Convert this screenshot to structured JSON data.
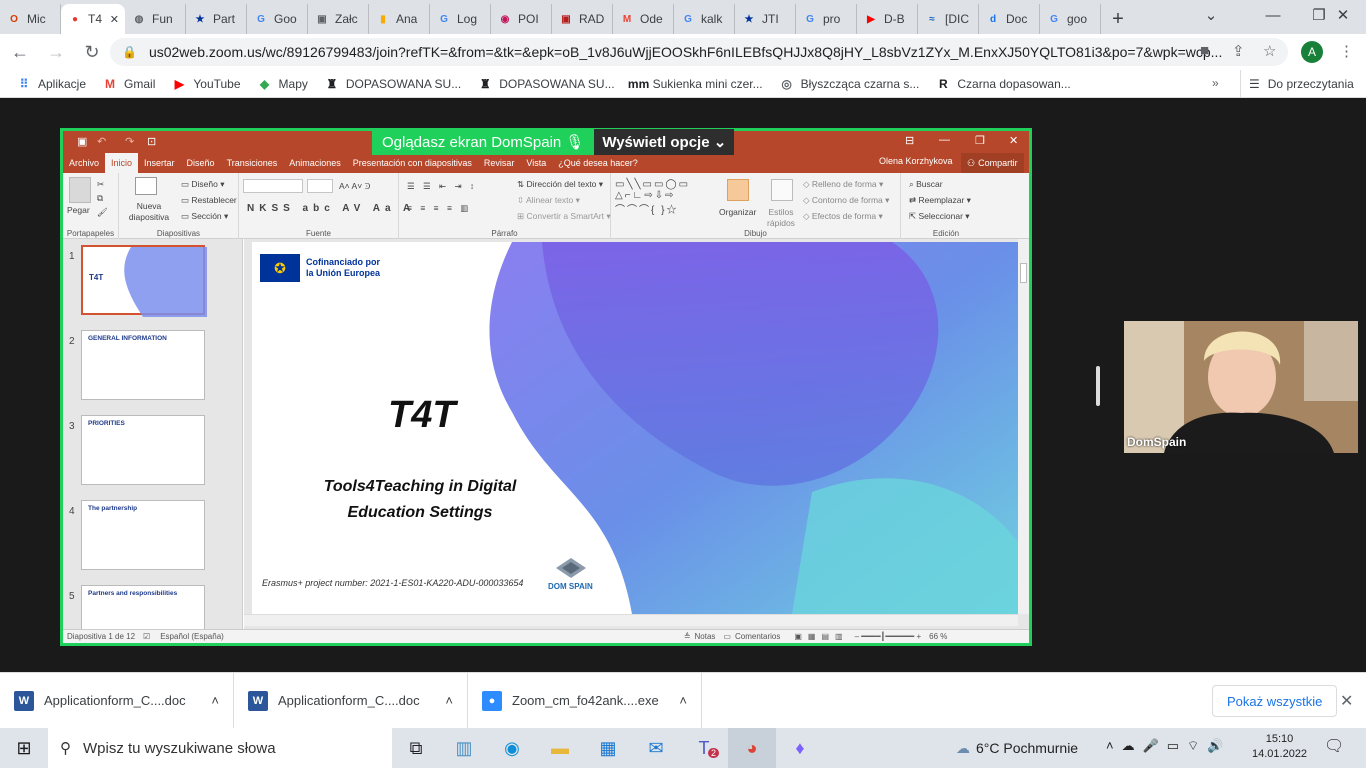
{
  "tabs": [
    {
      "label": "Mic",
      "icon": "office-icon",
      "color": "#d83b01",
      "glyph": "O"
    },
    {
      "label": "T4",
      "icon": "record-icon",
      "color": "#e53935",
      "glyph": "●",
      "active": true
    },
    {
      "label": "Fun",
      "icon": "globe-icon",
      "color": "#5f6368",
      "glyph": "◍"
    },
    {
      "label": "Part",
      "icon": "eu-flag-icon",
      "color": "#003399",
      "glyph": "★"
    },
    {
      "label": "Goo",
      "icon": "google-icon",
      "color": "#4285f4",
      "glyph": "G"
    },
    {
      "label": "Załc",
      "icon": "form-icon",
      "color": "#5f6368",
      "glyph": "▣"
    },
    {
      "label": "Ana",
      "icon": "analytics-icon",
      "color": "#f9ab00",
      "glyph": "▮"
    },
    {
      "label": "Log",
      "icon": "google-icon",
      "color": "#4285f4",
      "glyph": "G"
    },
    {
      "label": "POI",
      "icon": "record-icon",
      "color": "#c2185b",
      "glyph": "◉"
    },
    {
      "label": "RAD",
      "icon": "rad-icon",
      "color": "#b71c1c",
      "glyph": "▣"
    },
    {
      "label": "Ode",
      "icon": "gmail-icon",
      "color": "#ea4335",
      "glyph": "M"
    },
    {
      "label": "kalk",
      "icon": "google-icon",
      "color": "#4285f4",
      "glyph": "G"
    },
    {
      "label": "JTI",
      "icon": "eu-flag-icon",
      "color": "#003399",
      "glyph": "★"
    },
    {
      "label": "pro",
      "icon": "google-icon",
      "color": "#4285f4",
      "glyph": "G"
    },
    {
      "label": "D-B",
      "icon": "youtube-icon",
      "color": "#ff0000",
      "glyph": "▶"
    },
    {
      "label": "[DIC",
      "icon": "dic-icon",
      "color": "#1565c0",
      "glyph": "≈"
    },
    {
      "label": "Doc",
      "icon": "docs-icon",
      "color": "#1a73e8",
      "glyph": "d"
    },
    {
      "label": "goo",
      "icon": "google-icon",
      "color": "#4285f4",
      "glyph": "G"
    }
  ],
  "url": "us02web.zoom.us/wc/89126799483/join?refTK=&from=&tk=&epk=oB_1v8J6uWjjEOOSkhF6nILEBfsQHJJx8Q8jHY_L8sbVz1ZYx_M.EnxXJ50YQLTO81i3&po=7&wpk=wcp...",
  "avatar_letter": "A",
  "bookmarks": [
    {
      "label": "Aplikacje",
      "icon": "apps-grid-icon",
      "glyph": "⠿",
      "color": "#4285f4"
    },
    {
      "label": "Gmail",
      "icon": "gmail-icon",
      "glyph": "M",
      "color": "#ea4335"
    },
    {
      "label": "YouTube",
      "icon": "youtube-icon",
      "glyph": "▶",
      "color": "#ff0000"
    },
    {
      "label": "Mapy",
      "icon": "maps-icon",
      "glyph": "◆",
      "color": "#34a853"
    },
    {
      "label": "DOPASOWANA SU...",
      "icon": "shop-icon",
      "glyph": "♜",
      "color": "#202124"
    },
    {
      "label": "DOPASOWANA SU...",
      "icon": "shop-icon",
      "glyph": "♜",
      "color": "#202124"
    },
    {
      "label": "Sukienka mini czer...",
      "icon": "mm-icon",
      "glyph": "mm",
      "color": "#202124"
    },
    {
      "label": "Błyszcząca czarna s...",
      "icon": "shop-circle-icon",
      "glyph": "◎",
      "color": "#5f6368"
    },
    {
      "label": "Czarna dopasowan...",
      "icon": "r-icon",
      "glyph": "R",
      "color": "#202124"
    }
  ],
  "reading_list": "Do przeczytania",
  "share_banner": {
    "viewing": "Oglądasz ekran DomSpain",
    "options": "Wyświetl opcje"
  },
  "ppt": {
    "menu": [
      "Archivo",
      "Inicio",
      "Insertar",
      "Diseño",
      "Transiciones",
      "Animaciones",
      "Presentación con diapositivas",
      "Revisar",
      "Vista",
      "¿Qué desea hacer?"
    ],
    "user": "Olena Korzhykova",
    "share": "Compartir",
    "groups": {
      "clipboard": "Portapapeles",
      "slides": "Diapositivas",
      "font": "Fuente",
      "paragraph": "Párrafo",
      "drawing": "Dibujo",
      "editing": "Edición"
    },
    "paste": "Pegar",
    "new_slide": "Nueva diapositiva",
    "layout": "Diseño",
    "reset": "Restablecer",
    "section": "Sección",
    "text_direction": "Dirección del texto",
    "align_text": "Alinear texto",
    "smartart": "Convertir a SmartArt",
    "arrange": "Organizar",
    "quick_styles": "Estilos rápidos",
    "shape_fill": "Relleno de forma",
    "shape_outline": "Contorno de forma",
    "shape_effects": "Efectos de forma",
    "find": "Buscar",
    "replace": "Reemplazar",
    "select": "Seleccionar",
    "thumbs": [
      {
        "num": "1",
        "title": "T4T"
      },
      {
        "num": "2",
        "title": "GENERAL INFORMATION"
      },
      {
        "num": "3",
        "title": "PRIORITIES"
      },
      {
        "num": "4",
        "title": "The partnership"
      },
      {
        "num": "5",
        "title": "Partners and responsibilities"
      }
    ],
    "slide": {
      "logo_text_1": "Cofinanciado por",
      "logo_text_2": "la Unión Europea",
      "title": "T4T",
      "subtitle_1": "Tools4Teaching in Digital",
      "subtitle_2": "Education Settings",
      "project": "Erasmus+ project number: 2021-1-ES01-KA220-ADU-000033654",
      "brand": "DOM SPAIN"
    },
    "status": {
      "slide_of": "Diapositiva 1 de 12",
      "language": "Español (España)",
      "notes": "Notas",
      "comments": "Comentarios",
      "zoom": "66 %"
    }
  },
  "webcam_name": "DomSpain",
  "downloads": [
    {
      "name": "Applicationform_C....doc",
      "icon": "word-icon",
      "glyph": "W",
      "color": "#2b579a"
    },
    {
      "name": "Applicationform_C....doc",
      "icon": "word-icon",
      "glyph": "W",
      "color": "#2b579a"
    },
    {
      "name": "Zoom_cm_fo42ank....exe",
      "icon": "zoom-icon",
      "glyph": "●",
      "color": "#2d8cff"
    }
  ],
  "show_all": "Pokaż wszystkie",
  "taskbar": {
    "search": "Wpisz tu wyszukiwane słowa",
    "weather": "6°C  Pochmurnie",
    "time": "15:10",
    "date": "14.01.2022",
    "teams_badge": "2"
  }
}
